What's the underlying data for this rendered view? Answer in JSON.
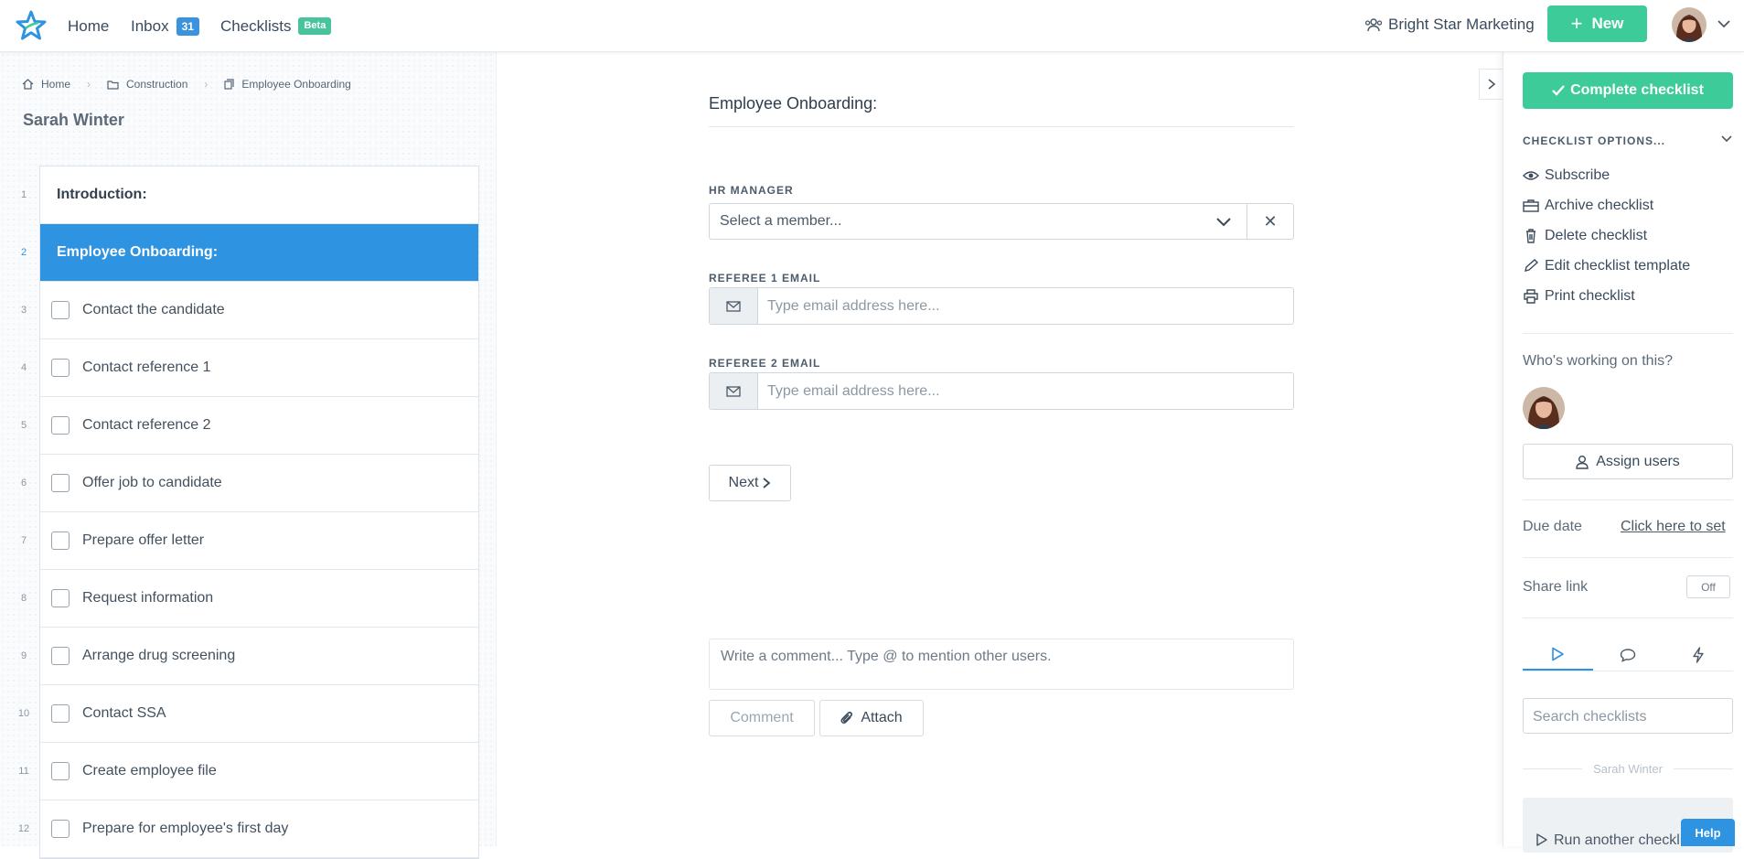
{
  "topbar": {
    "nav": [
      {
        "label": "Home"
      },
      {
        "label": "Inbox",
        "badge": "31"
      },
      {
        "label": "Checklists",
        "badge": "Beta"
      }
    ],
    "org_name": "Bright Star Marketing",
    "new_label": "New"
  },
  "breadcrumb": [
    "Home",
    "Construction",
    "Employee Onboarding"
  ],
  "checklist_owner": "Sarah Winter",
  "tasks": [
    {
      "num": "1",
      "label": "Introduction:",
      "type": "heading"
    },
    {
      "num": "2",
      "label": "Employee Onboarding:",
      "type": "heading",
      "active": true
    },
    {
      "num": "3",
      "label": "Contact the candidate"
    },
    {
      "num": "4",
      "label": "Contact reference 1"
    },
    {
      "num": "5",
      "label": "Contact reference 2"
    },
    {
      "num": "6",
      "label": "Offer job to candidate"
    },
    {
      "num": "7",
      "label": "Prepare offer letter"
    },
    {
      "num": "8",
      "label": "Request information"
    },
    {
      "num": "9",
      "label": "Arrange drug screening"
    },
    {
      "num": "10",
      "label": "Contact SSA"
    },
    {
      "num": "11",
      "label": "Create employee file"
    },
    {
      "num": "12",
      "label": "Prepare for employee's first day"
    }
  ],
  "main": {
    "title": "Employee Onboarding:",
    "hr_manager_label": "HR MANAGER",
    "hr_manager_placeholder": "Select a member...",
    "referee1_label": "REFEREE 1 EMAIL",
    "referee2_label": "REFEREE 2 EMAIL",
    "email_placeholder": "Type email address here...",
    "next_label": "Next",
    "comment_placeholder": "Write a comment... Type @ to mention other users.",
    "comment_label": "Comment",
    "attach_label": "Attach"
  },
  "sidebar": {
    "complete_label": "Complete checklist",
    "options_header": "CHECKLIST OPTIONS...",
    "options": [
      {
        "label": "Subscribe",
        "icon": "eye-icon"
      },
      {
        "label": "Archive checklist",
        "icon": "archive-icon"
      },
      {
        "label": "Delete checklist",
        "icon": "trash-icon"
      },
      {
        "label": "Edit checklist template",
        "icon": "pencil-icon"
      },
      {
        "label": "Print checklist",
        "icon": "printer-icon"
      }
    ],
    "working_label": "Who's working on this?",
    "assign_label": "Assign users",
    "due_label": "Due date",
    "due_link": "Click here to set",
    "share_label": "Share link",
    "share_toggle": "Off",
    "search_placeholder": "Search checklists",
    "group_name": "Sarah Winter",
    "run_another": "Run another checklist",
    "help_label": "Help"
  },
  "colors": {
    "accent_green": "#3ecb9a",
    "accent_blue": "#2e93e0"
  }
}
